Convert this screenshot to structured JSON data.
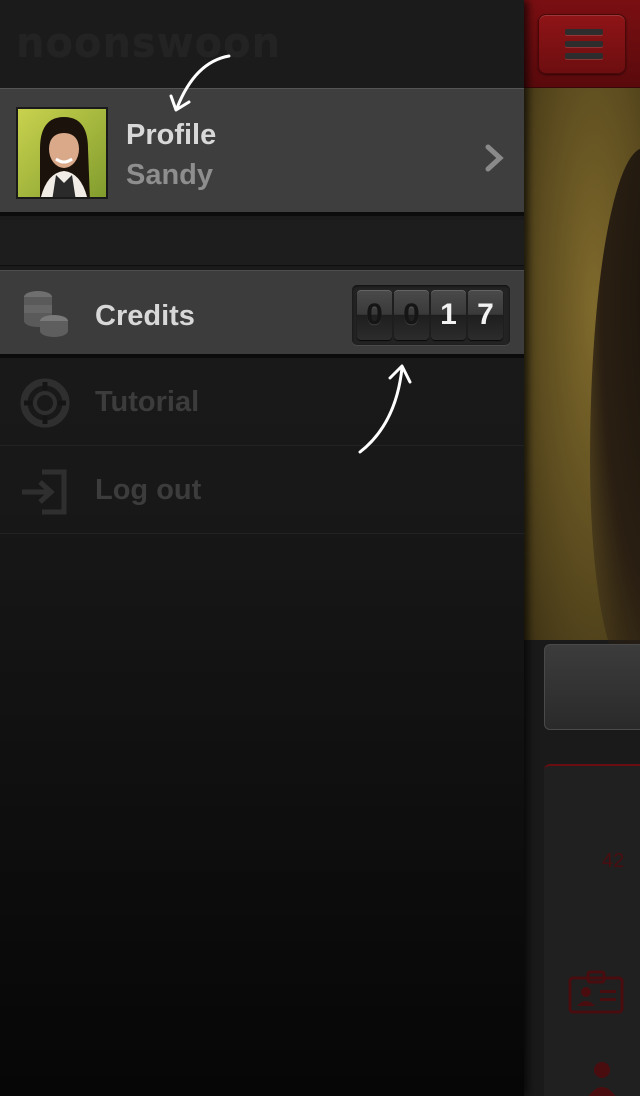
{
  "app": {
    "logo_text": "noonswoon"
  },
  "profile": {
    "title": "Profile",
    "name": "Sandy"
  },
  "menu": {
    "items": [
      {
        "label": "Credits",
        "icon": "coins-icon",
        "selected": true
      },
      {
        "label": "Tutorial",
        "icon": "lifebuoy-icon",
        "selected": false
      },
      {
        "label": "Log out",
        "icon": "logout-icon",
        "selected": false
      }
    ]
  },
  "credits": {
    "digits": [
      "0",
      "0",
      "1",
      "7"
    ],
    "value": 17
  },
  "content": {
    "percent_text": "42"
  },
  "colors": {
    "accent": "#7a0f12",
    "menu_bg": "#1b1b1b",
    "selected_row": "#3c3c3c"
  }
}
